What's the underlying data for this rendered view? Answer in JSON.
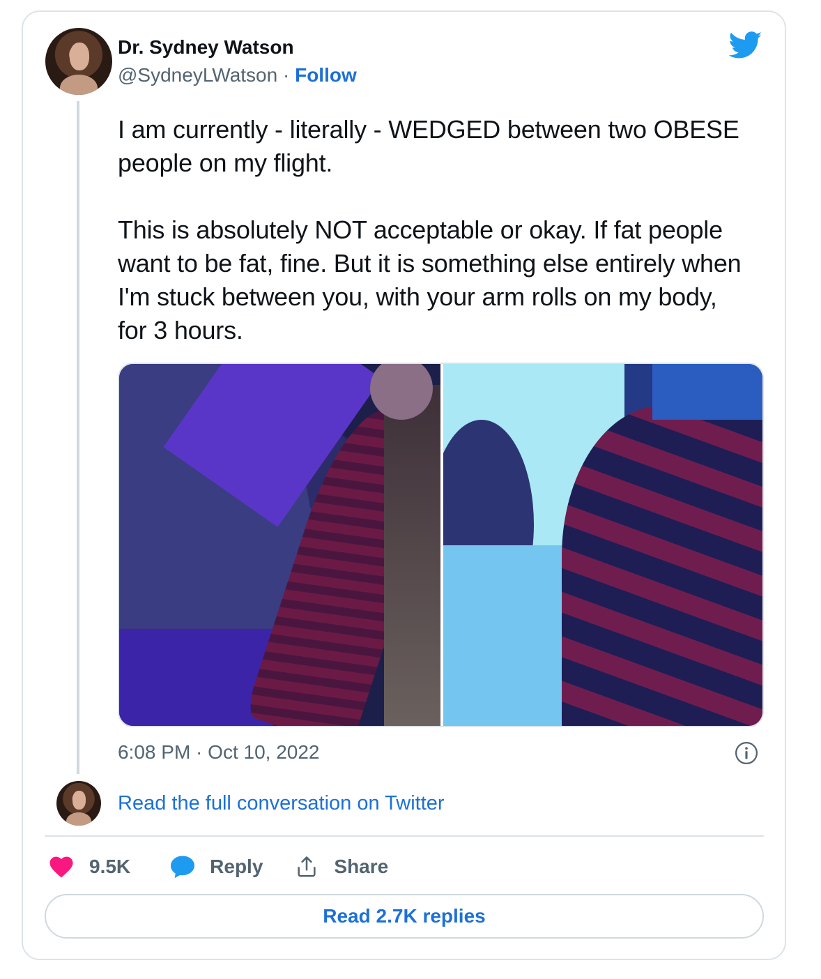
{
  "author": {
    "name": "Dr. Sydney Watson",
    "handle": "@SydneyLWatson",
    "separator": "·",
    "follow_label": "Follow"
  },
  "tweet": {
    "text": "I am currently - literally - WEDGED between two OBESE people on my flight.\n\nThis is absolutely NOT acceptable or okay. If fat people want to be fat, fine. But it is something else entirely when I'm stuck between you, with your arm rolls on my body, for 3 hours.",
    "timestamp": "6:08 PM · Oct 10, 2022"
  },
  "conversation_link": "Read the full conversation on Twitter",
  "actions": {
    "like_count": "9.5K",
    "reply_label": "Reply",
    "share_label": "Share"
  },
  "replies_button": "Read 2.7K replies",
  "icons": {
    "brand": "twitter-bird-icon",
    "info": "info-icon",
    "like": "heart-icon",
    "reply": "speech-bubble-icon",
    "share": "share-upload-icon"
  },
  "colors": {
    "link": "#1d70d6",
    "twitter_blue": "#1d9bf0",
    "like": "#f91880",
    "muted": "#536471",
    "text": "#0f1419",
    "border": "#dde3e8"
  }
}
